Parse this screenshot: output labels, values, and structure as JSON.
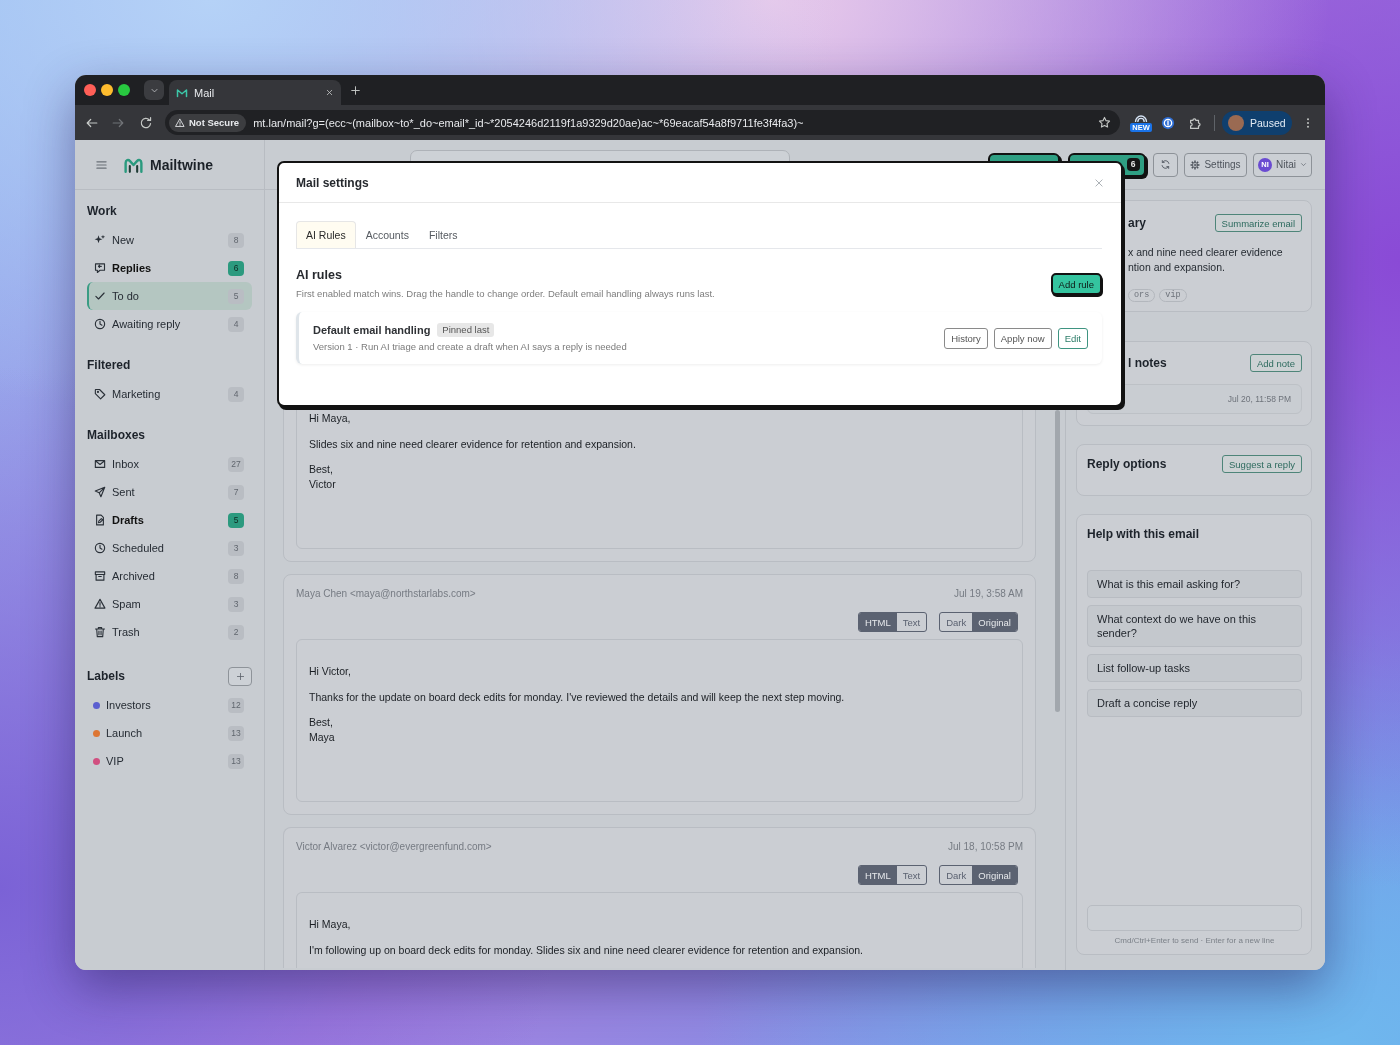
{
  "browser": {
    "tabs": [
      {
        "title": "Mail",
        "selected": true
      }
    ],
    "security_label": "Not Secure",
    "url": "mt.lan/mail?g=(ecc~(mailbox~to*_do~email*_id~*2054246d2119f1a9329d20ae)ac~*69eacaf54a8f9711fe3f4fa3)~",
    "extension_badge": "NEW",
    "profile_status": "Paused"
  },
  "app": {
    "name": "Mailtwine"
  },
  "sidebar": {
    "sections": [
      {
        "title": "Work",
        "items": [
          {
            "label": "New",
            "count": "8",
            "selected": false,
            "unread": false
          },
          {
            "label": "Replies",
            "count": "6",
            "selected": false,
            "unread": true
          },
          {
            "label": "To do",
            "count": "5",
            "selected": true,
            "unread": false
          },
          {
            "label": "Awaiting reply",
            "count": "4",
            "selected": false,
            "unread": false
          }
        ]
      },
      {
        "title": "Filtered",
        "items": [
          {
            "label": "Marketing",
            "count": "4",
            "selected": false,
            "unread": false
          }
        ]
      },
      {
        "title": "Mailboxes",
        "items": [
          {
            "label": "Inbox",
            "count": "27",
            "selected": false,
            "unread": false
          },
          {
            "label": "Sent",
            "count": "7",
            "selected": false,
            "unread": false
          },
          {
            "label": "Drafts",
            "count": "5",
            "selected": false,
            "unread": true
          },
          {
            "label": "Scheduled",
            "count": "3",
            "selected": false,
            "unread": false
          },
          {
            "label": "Archived",
            "count": "8",
            "selected": false,
            "unread": false
          },
          {
            "label": "Spam",
            "count": "3",
            "selected": false,
            "unread": false
          },
          {
            "label": "Trash",
            "count": "2",
            "selected": false,
            "unread": false
          }
        ]
      }
    ],
    "labels": {
      "title": "Labels",
      "items": [
        {
          "name": "Investors",
          "count": "12",
          "color": "#5b5fd0"
        },
        {
          "name": "Launch",
          "count": "13",
          "color": "#dd7634"
        },
        {
          "name": "VIP",
          "count": "13",
          "color": "#d14f80"
        }
      ]
    }
  },
  "top_bar": {
    "actions": [
      {
        "kind": "primary"
      },
      {
        "kind": "primary",
        "badge": "6"
      },
      {
        "kind": "refresh"
      },
      {
        "kind": "settings",
        "label": "Settings"
      },
      {
        "kind": "account",
        "initials": "NI",
        "label": "Nitai"
      }
    ]
  },
  "messages": [
    {
      "body": [
        "Hi Maya,",
        "Slides six and nine need clearer evidence for retention and expansion.",
        "Best,\nVictor"
      ]
    },
    {
      "from": "Maya Chen <maya@northstarlabs.com>",
      "date": "Jul 19, 3:58 AM",
      "format": [
        {
          "label": "HTML",
          "selected": true
        },
        {
          "label": "Text",
          "selected": false
        }
      ],
      "appearance": [
        {
          "label": "Dark",
          "selected": false
        },
        {
          "label": "Original",
          "selected": true
        }
      ],
      "body": [
        "Hi Victor,",
        "Thanks for the update on board deck edits for monday. I've reviewed the details and will keep the next step moving.",
        "Best,\nMaya"
      ]
    },
    {
      "from": "Victor Alvarez <victor@evergreenfund.com>",
      "date": "Jul 18, 10:58 PM",
      "format": [
        {
          "label": "HTML",
          "selected": true
        },
        {
          "label": "Text",
          "selected": false
        }
      ],
      "appearance": [
        {
          "label": "Dark",
          "selected": false
        },
        {
          "label": "Original",
          "selected": true
        }
      ],
      "body": [
        "Hi Maya,",
        "I'm following up on board deck edits for monday. Slides six and nine need clearer evidence for retention and expansion."
      ]
    }
  ],
  "side_panel": {
    "summary": {
      "title": "ary",
      "button": "Summarize email",
      "lines": [
        "x and nine need clearer evidence",
        "ntion and expansion."
      ],
      "tags": [
        "ors",
        "vip"
      ]
    },
    "notes": {
      "title": "l notes",
      "button": "Add note",
      "items": [
        {
          "date": "Jul 20, 11:58 PM"
        }
      ]
    },
    "reply_options": {
      "title": "Reply options",
      "button": "Suggest a reply"
    },
    "assistant": {
      "title": "Help with this email",
      "prompts": [
        "What is this email asking for?",
        "What context do we have on this sender?",
        "List follow-up tasks",
        "Draft a concise reply"
      ],
      "hint": "Cmd/Ctrl+Enter to send · Enter for a new line"
    }
  },
  "dialog": {
    "title": "Mail settings",
    "tabs": [
      {
        "label": "AI Rules",
        "selected": true
      },
      {
        "label": "Accounts",
        "selected": false
      },
      {
        "label": "Filters",
        "selected": false
      }
    ],
    "heading": "AI rules",
    "description": "First enabled match wins. Drag the handle to change order. Default email handling always runs last.",
    "add_button": "Add rule",
    "rules": [
      {
        "name": "Default email handling",
        "badge": "Pinned last",
        "summary": "Version 1 · Run AI triage and create a draft when AI says a reply is needed",
        "actions": [
          {
            "label": "History",
            "kind": "secondary"
          },
          {
            "label": "Apply now",
            "kind": "secondary"
          },
          {
            "label": "Edit",
            "kind": "primary"
          }
        ]
      }
    ]
  }
}
